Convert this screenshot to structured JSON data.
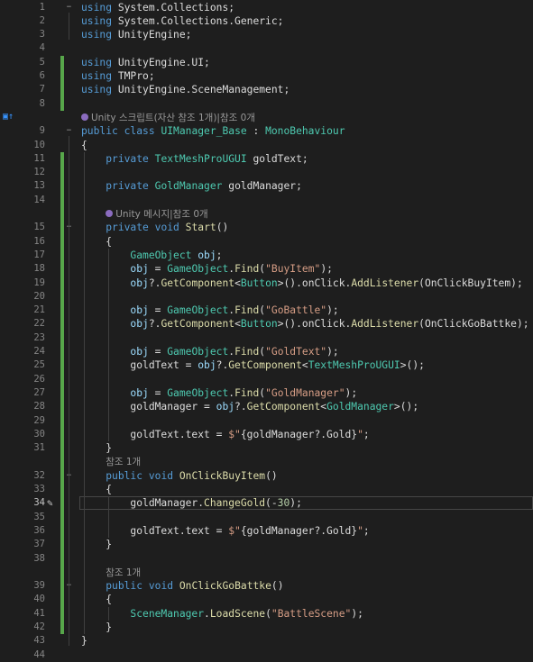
{
  "editor": {
    "current_line": 34,
    "rows": [
      {
        "n": "1",
        "t": [
          [
            "kw",
            "using"
          ],
          [
            "pl",
            " System.Collections;"
          ]
        ]
      },
      {
        "n": "2",
        "t": [
          [
            "kw",
            "using"
          ],
          [
            "pl",
            " System.Collections.Generic;"
          ]
        ]
      },
      {
        "n": "3",
        "t": [
          [
            "kw",
            "using"
          ],
          [
            "pl",
            " UnityEngine;"
          ]
        ]
      },
      {
        "n": "4",
        "t": []
      },
      {
        "n": "5",
        "t": [
          [
            "kw",
            "using"
          ],
          [
            "pl",
            " UnityEngine.UI;"
          ]
        ]
      },
      {
        "n": "6",
        "t": [
          [
            "kw",
            "using"
          ],
          [
            "pl",
            " TMPro;"
          ]
        ]
      },
      {
        "n": "7",
        "t": [
          [
            "kw",
            "using"
          ],
          [
            "pl",
            " UnityEngine.SceneManagement;"
          ]
        ]
      },
      {
        "n": "8",
        "t": []
      },
      {
        "lens": "Unity 스크립트(자산 참조 1개)|참조 0개",
        "icon": true
      },
      {
        "n": "9",
        "t": [
          [
            "kw",
            "public"
          ],
          [
            "pl",
            " "
          ],
          [
            "kw",
            "class"
          ],
          [
            "pl",
            " "
          ],
          [
            "ty",
            "UIManager_Base"
          ],
          [
            "pl",
            " : "
          ],
          [
            "ty",
            "MonoBehaviour"
          ]
        ]
      },
      {
        "n": "10",
        "t": [
          [
            "pl",
            "{"
          ]
        ]
      },
      {
        "n": "11",
        "t": [
          [
            "pl",
            "    "
          ],
          [
            "kw",
            "private"
          ],
          [
            "pl",
            " "
          ],
          [
            "ty",
            "TextMeshProUGUI"
          ],
          [
            "pl",
            " goldText;"
          ]
        ]
      },
      {
        "n": "12",
        "t": []
      },
      {
        "n": "13",
        "t": [
          [
            "pl",
            "    "
          ],
          [
            "kw",
            "private"
          ],
          [
            "pl",
            " "
          ],
          [
            "ty",
            "GoldManager"
          ],
          [
            "pl",
            " goldManager;"
          ]
        ]
      },
      {
        "n": "14",
        "t": []
      },
      {
        "lens": "Unity 메시지|참조 0개",
        "icon": true,
        "indent": "    "
      },
      {
        "n": "15",
        "t": [
          [
            "pl",
            "    "
          ],
          [
            "kw",
            "private"
          ],
          [
            "pl",
            " "
          ],
          [
            "kw",
            "void"
          ],
          [
            "pl",
            " "
          ],
          [
            "fn",
            "Start"
          ],
          [
            "pl",
            "()"
          ]
        ]
      },
      {
        "n": "16",
        "t": [
          [
            "pl",
            "    {"
          ]
        ]
      },
      {
        "n": "17",
        "t": [
          [
            "pl",
            "        "
          ],
          [
            "ty",
            "GameObject"
          ],
          [
            "pl",
            " "
          ],
          [
            "id",
            "obj"
          ],
          [
            "pl",
            ";"
          ]
        ]
      },
      {
        "n": "18",
        "t": [
          [
            "pl",
            "        "
          ],
          [
            "id",
            "obj"
          ],
          [
            "pl",
            " = "
          ],
          [
            "ty",
            "GameObject"
          ],
          [
            "pl",
            "."
          ],
          [
            "fn",
            "Find"
          ],
          [
            "pl",
            "("
          ],
          [
            "st",
            "\"BuyItem\""
          ],
          [
            "pl",
            ");"
          ]
        ]
      },
      {
        "n": "19",
        "t": [
          [
            "pl",
            "        "
          ],
          [
            "id",
            "obj"
          ],
          [
            "pl",
            "?."
          ],
          [
            "fn",
            "GetComponent"
          ],
          [
            "pl",
            "<"
          ],
          [
            "ty",
            "Button"
          ],
          [
            "pl",
            ">().onClick."
          ],
          [
            "fn",
            "AddListener"
          ],
          [
            "pl",
            "(OnClickBuyItem);"
          ]
        ]
      },
      {
        "n": "20",
        "t": []
      },
      {
        "n": "21",
        "t": [
          [
            "pl",
            "        "
          ],
          [
            "id",
            "obj"
          ],
          [
            "pl",
            " = "
          ],
          [
            "ty",
            "GameObject"
          ],
          [
            "pl",
            "."
          ],
          [
            "fn",
            "Find"
          ],
          [
            "pl",
            "("
          ],
          [
            "st",
            "\"GoBattle\""
          ],
          [
            "pl",
            ");"
          ]
        ]
      },
      {
        "n": "22",
        "t": [
          [
            "pl",
            "        "
          ],
          [
            "id",
            "obj"
          ],
          [
            "pl",
            "?."
          ],
          [
            "fn",
            "GetComponent"
          ],
          [
            "pl",
            "<"
          ],
          [
            "ty",
            "Button"
          ],
          [
            "pl",
            ">().onClick."
          ],
          [
            "fn",
            "AddListener"
          ],
          [
            "pl",
            "(OnClickGoBattke);"
          ]
        ]
      },
      {
        "n": "23",
        "t": []
      },
      {
        "n": "24",
        "t": [
          [
            "pl",
            "        "
          ],
          [
            "id",
            "obj"
          ],
          [
            "pl",
            " = "
          ],
          [
            "ty",
            "GameObject"
          ],
          [
            "pl",
            "."
          ],
          [
            "fn",
            "Find"
          ],
          [
            "pl",
            "("
          ],
          [
            "st",
            "\"GoldText\""
          ],
          [
            "pl",
            ");"
          ]
        ]
      },
      {
        "n": "25",
        "t": [
          [
            "pl",
            "        goldText = "
          ],
          [
            "id",
            "obj"
          ],
          [
            "pl",
            "?."
          ],
          [
            "fn",
            "GetComponent"
          ],
          [
            "pl",
            "<"
          ],
          [
            "ty",
            "TextMeshProUGUI"
          ],
          [
            "pl",
            ">();"
          ]
        ]
      },
      {
        "n": "26",
        "t": []
      },
      {
        "n": "27",
        "t": [
          [
            "pl",
            "        "
          ],
          [
            "id",
            "obj"
          ],
          [
            "pl",
            " = "
          ],
          [
            "ty",
            "GameObject"
          ],
          [
            "pl",
            "."
          ],
          [
            "fn",
            "Find"
          ],
          [
            "pl",
            "("
          ],
          [
            "st",
            "\"GoldManager\""
          ],
          [
            "pl",
            ");"
          ]
        ]
      },
      {
        "n": "28",
        "t": [
          [
            "pl",
            "        goldManager = "
          ],
          [
            "id",
            "obj"
          ],
          [
            "pl",
            "?."
          ],
          [
            "fn",
            "GetComponent"
          ],
          [
            "pl",
            "<"
          ],
          [
            "ty",
            "GoldManager"
          ],
          [
            "pl",
            ">();"
          ]
        ]
      },
      {
        "n": "29",
        "t": []
      },
      {
        "n": "30",
        "t": [
          [
            "pl",
            "        goldText.text = "
          ],
          [
            "st",
            "$\""
          ],
          [
            "pl",
            "{goldManager?.Gold}"
          ],
          [
            "st",
            "\""
          ],
          [
            "pl",
            ";"
          ]
        ]
      },
      {
        "n": "31",
        "t": [
          [
            "pl",
            "    }"
          ]
        ]
      },
      {
        "lens": "참조 1개",
        "indent": "    "
      },
      {
        "n": "32",
        "t": [
          [
            "pl",
            "    "
          ],
          [
            "kw",
            "public"
          ],
          [
            "pl",
            " "
          ],
          [
            "kw",
            "void"
          ],
          [
            "pl",
            " "
          ],
          [
            "fn",
            "OnClickBuyItem"
          ],
          [
            "pl",
            "()"
          ]
        ]
      },
      {
        "n": "33",
        "t": [
          [
            "pl",
            "    {"
          ]
        ]
      },
      {
        "n": "34",
        "t": [
          [
            "pl",
            "        goldManager."
          ],
          [
            "fn",
            "ChangeGold"
          ],
          [
            "pl",
            "(-"
          ],
          [
            "nm",
            "30"
          ],
          [
            "pl",
            ");"
          ]
        ]
      },
      {
        "n": "35",
        "t": []
      },
      {
        "n": "36",
        "t": [
          [
            "pl",
            "        goldText.text = "
          ],
          [
            "st",
            "$\""
          ],
          [
            "pl",
            "{goldManager?.Gold}"
          ],
          [
            "st",
            "\""
          ],
          [
            "pl",
            ";"
          ]
        ]
      },
      {
        "n": "37",
        "t": [
          [
            "pl",
            "    }"
          ]
        ]
      },
      {
        "n": "38",
        "t": []
      },
      {
        "lens": "참조 1개",
        "indent": "    "
      },
      {
        "n": "39",
        "t": [
          [
            "pl",
            "    "
          ],
          [
            "kw",
            "public"
          ],
          [
            "pl",
            " "
          ],
          [
            "kw",
            "void"
          ],
          [
            "pl",
            " "
          ],
          [
            "fn",
            "OnClickGoBattke"
          ],
          [
            "pl",
            "()"
          ]
        ]
      },
      {
        "n": "40",
        "t": [
          [
            "pl",
            "    {"
          ]
        ]
      },
      {
        "n": "41",
        "t": [
          [
            "pl",
            "        "
          ],
          [
            "ty",
            "SceneManager"
          ],
          [
            "pl",
            "."
          ],
          [
            "fn",
            "LoadScene"
          ],
          [
            "pl",
            "("
          ],
          [
            "st",
            "\"BattleScene\""
          ],
          [
            "pl",
            ");"
          ]
        ]
      },
      {
        "n": "42",
        "t": [
          [
            "pl",
            "    }"
          ]
        ]
      },
      {
        "n": "43",
        "t": [
          [
            "pl",
            "}"
          ]
        ]
      },
      {
        "n": "44",
        "t": []
      }
    ],
    "colors": {
      "background": "#1e1e1e",
      "keyword": "#569cd6",
      "type": "#4ec9b0",
      "method": "#dcdcaa",
      "string": "#d69d85",
      "number": "#b5cea8",
      "local": "#9cdcfe",
      "text": "#dcdcdc",
      "line_number": "#858585",
      "change_bar": "#57a64a"
    }
  }
}
